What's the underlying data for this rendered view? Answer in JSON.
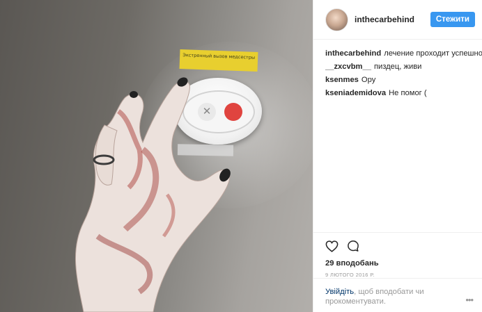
{
  "post": {
    "sign_text": "Экстренный вызов медсестры",
    "author": {
      "username": "inthecarbehind",
      "follow_label": "Стежити"
    },
    "comments": [
      {
        "user": "inthecarbehind",
        "text": "лечение проходит успешно"
      },
      {
        "user": "__zxcvbm__",
        "text": "пиздец, живи"
      },
      {
        "user": "ksenmes",
        "text": "Ору"
      },
      {
        "user": "kseniademidova",
        "text": "Не помог ("
      }
    ],
    "likes_label": "29 вподобань",
    "date_label": "9 лютого 2016 р.",
    "login_prompt": {
      "link_text": "Увійдіть",
      "rest_text": ", щоб вподобати чи прокоментувати."
    },
    "more_label": "•••",
    "icons": {
      "like": "heart-icon",
      "comment": "comment-bubble-icon",
      "more": "more-options-icon"
    },
    "colors": {
      "accent": "#3897f0",
      "link": "#003569",
      "muted": "#999999"
    }
  }
}
